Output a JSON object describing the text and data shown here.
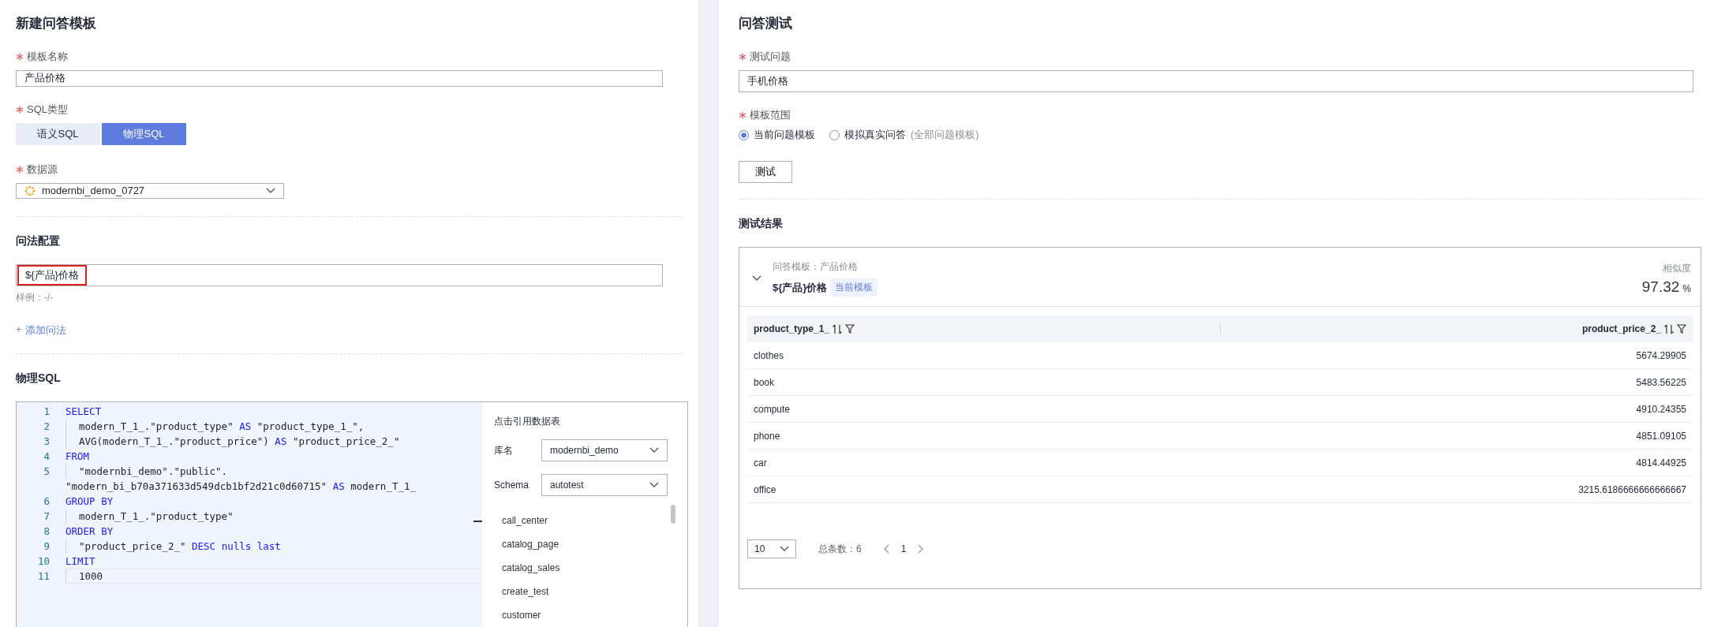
{
  "template_form": {
    "title": "新建问答模板",
    "name_field": {
      "label": "模板名称",
      "required": true,
      "value": "产品价格"
    },
    "sql_type": {
      "label": "SQL类型",
      "required": true,
      "options": [
        {
          "label": "语义SQL",
          "selected": false
        },
        {
          "label": "物理SQL",
          "selected": true
        }
      ]
    },
    "datasource": {
      "label": "数据源",
      "required": true,
      "value": "modernbi_demo_0727"
    },
    "phrasing": {
      "title": "问法配置",
      "value": "${产品}价格",
      "hint": "样例：-/-",
      "add_link": "添加问法",
      "add_icon": "+"
    },
    "physical_sql": {
      "title": "物理SQL",
      "lines": [
        {
          "number": "1",
          "indented": false,
          "current": false,
          "tokens": [
            {
              "text": "SELECT",
              "kind": "keyword"
            }
          ]
        },
        {
          "number": "2",
          "indented": true,
          "current": false,
          "tokens": [
            {
              "text": "modern_T_1_.\"product_type\" ",
              "kind": "plain"
            },
            {
              "text": "AS",
              "kind": "keyword"
            },
            {
              "text": " \"product_type_1_\",",
              "kind": "plain"
            }
          ]
        },
        {
          "number": "3",
          "indented": true,
          "current": false,
          "tokens": [
            {
              "text": "AVG(modern_T_1_.\"product_price\") ",
              "kind": "plain"
            },
            {
              "text": "AS",
              "kind": "keyword"
            },
            {
              "text": " \"product_price_2_\"",
              "kind": "plain"
            }
          ]
        },
        {
          "number": "4",
          "indented": false,
          "current": false,
          "tokens": [
            {
              "text": "FROM",
              "kind": "keyword"
            }
          ]
        },
        {
          "number": "5",
          "indented": true,
          "current": false,
          "tokens": [
            {
              "text": "\"modernbi_demo\".\"public\".",
              "kind": "plain"
            }
          ]
        },
        {
          "indented": false,
          "current": false,
          "tokens": [
            {
              "text": "\"modern_bi_b70a371633d549dcb1bf2d21c0d60715\" ",
              "kind": "plain"
            },
            {
              "text": "AS",
              "kind": "keyword"
            },
            {
              "text": " modern_T_1_",
              "kind": "plain"
            }
          ]
        },
        {
          "number": "6",
          "indented": false,
          "current": false,
          "tokens": [
            {
              "text": "GROUP BY",
              "kind": "keyword"
            }
          ]
        },
        {
          "number": "7",
          "indented": true,
          "current": false,
          "tokens": [
            {
              "text": "modern_T_1_.\"product_type\"",
              "kind": "plain"
            }
          ]
        },
        {
          "number": "8",
          "indented": false,
          "current": false,
          "tokens": [
            {
              "text": "ORDER BY",
              "kind": "keyword"
            }
          ]
        },
        {
          "number": "9",
          "indented": true,
          "current": false,
          "tokens": [
            {
              "text": "\"product_price_2_\" ",
              "kind": "plain"
            },
            {
              "text": "DESC nulls last",
              "kind": "keyword"
            }
          ]
        },
        {
          "number": "10",
          "indented": false,
          "current": false,
          "tokens": [
            {
              "text": "LIMIT",
              "kind": "keyword"
            }
          ]
        },
        {
          "number": "11",
          "indented": true,
          "current": true,
          "tokens": [
            {
              "text": "1000",
              "kind": "plain"
            }
          ]
        }
      ],
      "table_picker": {
        "title": "点击引用数据表",
        "database_label": "库名",
        "database": "modernbi_demo",
        "schema_label": "Schema",
        "schema": "autotest",
        "tables": [
          "call_center",
          "catalog_page",
          "catalog_sales",
          "create_test",
          "customer"
        ]
      }
    }
  },
  "qa_test": {
    "title": "问答测试",
    "question": {
      "label": "测试问题",
      "required": true,
      "value": "手机价格"
    },
    "scope": {
      "label": "模板范围",
      "required": true,
      "options": [
        {
          "label": "当前问题模板",
          "selected": true
        },
        {
          "label": "模拟真实问答",
          "note": "(全部问题模板)",
          "selected": false
        }
      ]
    },
    "test_button": "测试",
    "results_title": "测试结果",
    "result": {
      "expanded": true,
      "template_line": "问答模板：产品价格",
      "phrase": "${产品}价格",
      "tag": "当前模板",
      "similarity_label": "相似度",
      "similarity": "97.32",
      "unit": "%",
      "columns": [
        "product_type_1_",
        "product_price_2_"
      ],
      "rows": [
        [
          "clothes",
          "5674.29905"
        ],
        [
          "book",
          "5483.56225"
        ],
        [
          "compute",
          "4910.24355"
        ],
        [
          "phone",
          "4851.09105"
        ],
        [
          "car",
          "4814.44925"
        ],
        [
          "office",
          "3215.6186666666666667"
        ]
      ],
      "page_size": "10",
      "total": "总条数：6",
      "page": "1"
    }
  }
}
